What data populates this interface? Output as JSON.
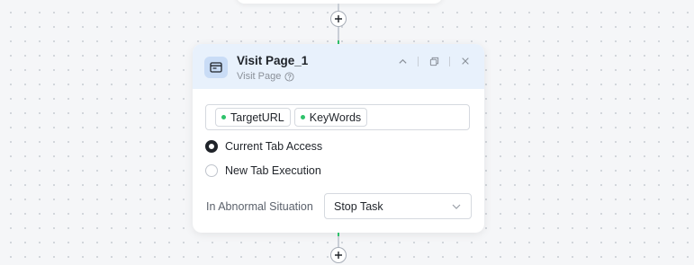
{
  "node": {
    "title": "Visit Page_1",
    "subtitle": "Visit Page",
    "tags": [
      "TargetURL",
      "KeyWords"
    ],
    "options": [
      {
        "label": "Current Tab Access",
        "checked": true
      },
      {
        "label": "New Tab Execution",
        "checked": false
      }
    ],
    "abnormal_label": "In Abnormal Situation",
    "abnormal_value": "Stop Task"
  },
  "icons": {
    "node_icon": "browser-window-icon",
    "help": "question-circle-icon",
    "collapse": "chevron-up-icon",
    "copy": "copy-icon",
    "close": "close-icon",
    "add": "plus-icon",
    "dropdown": "chevron-down-icon"
  },
  "colors": {
    "accent_green": "#2ec26a",
    "header_bg": "#e8f1fc"
  }
}
